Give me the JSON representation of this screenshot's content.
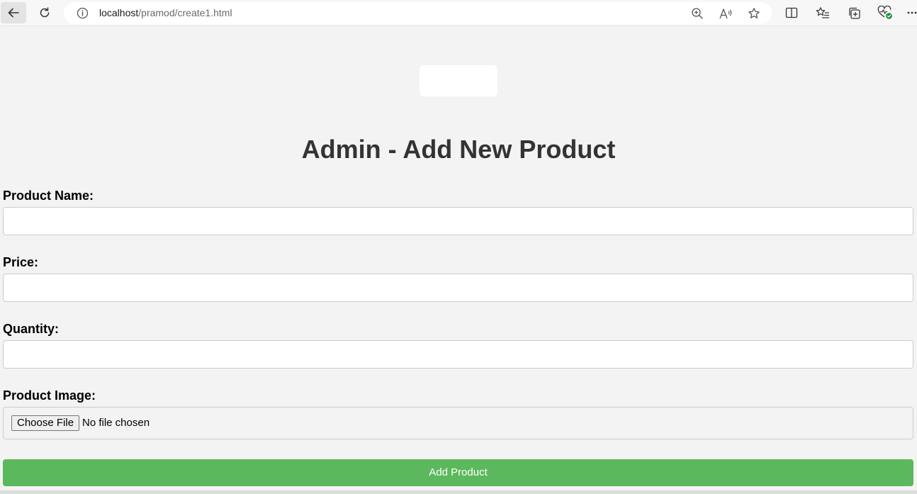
{
  "browser": {
    "url_host": "localhost",
    "url_path": "/pramod/create1.html",
    "icons": {
      "back": "back-arrow-icon",
      "reload": "reload-icon",
      "info": "info-icon",
      "zoom": "zoom-icon",
      "read_aloud": "read-aloud-icon",
      "favorite": "star-icon",
      "split_screen": "split-screen-icon",
      "favorites": "favorites-list-icon",
      "collections": "collections-icon",
      "health": "browser-essentials-icon",
      "more": "more-icon"
    }
  },
  "page": {
    "title": "Admin - Add New Product",
    "form": {
      "product_name_label": "Product Name:",
      "product_name_value": "",
      "price_label": "Price:",
      "price_value": "",
      "quantity_label": "Quantity:",
      "quantity_value": "",
      "image_label": "Product Image:",
      "choose_file_label": "Choose File",
      "file_status": "No file chosen",
      "submit_label": "Add Product"
    }
  },
  "colors": {
    "page_background": "#f3f3f3",
    "title_text": "#333333",
    "submit_button": "#5cb85c",
    "health_badge": "#1a8a3a"
  }
}
